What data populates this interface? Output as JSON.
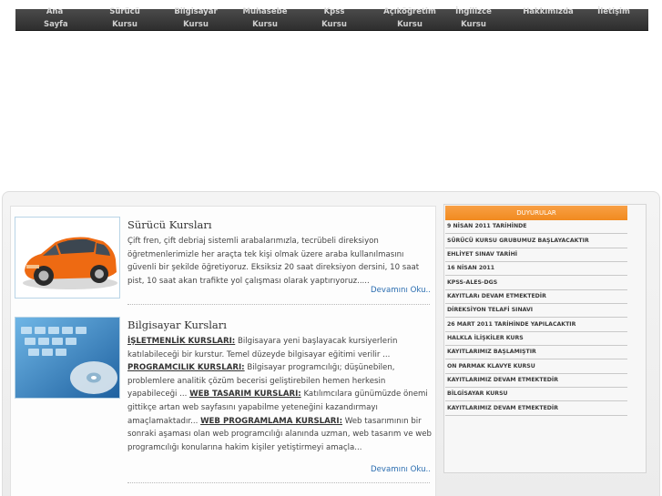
{
  "nav": {
    "items": [
      {
        "line1": "Ana",
        "line2": "Sayfa"
      },
      {
        "line1": "Sürücü",
        "line2": "Kursu"
      },
      {
        "line1": "Bilgisayar",
        "line2": "Kursu"
      },
      {
        "line1": "Muhasebe",
        "line2": "Kursu"
      },
      {
        "line1": "Kpss",
        "line2": "Kursu"
      },
      {
        "line1": "Açıköğretim",
        "line2": "Kursu"
      },
      {
        "line1": "İngilizce",
        "line2": "Kursu"
      },
      {
        "line1": "Hakkımızda",
        "line2": ""
      },
      {
        "line1": "İletişim",
        "line2": ""
      }
    ]
  },
  "courses": [
    {
      "title": "Sürücü Kursları",
      "text": "Çift fren, çift debriaj sistemli arabalarımızla, tecrübeli direksiyon öğretmenlerimizle her araçta tek kişi olmak üzere araba kullanılmasını güvenli bir şekilde öğretiyoruz. Eksiksiz 20 saat direksiyon dersini, 10 saat pist, 10 saat akan trafikte yol çalışması olarak yaptırıyoruz.....",
      "more": "Devamını Oku.."
    },
    {
      "title": "Bilgisayar Kursları",
      "p1_head": "İŞLETMENLİK KURSLARI:",
      "p1": " Bilgisayara yeni başlayacak kursiyerlerin katılabileceği bir kurstur. Temel düzeyde bilgisayar eğitimi verilir ...",
      "p2_head": "PROGRAMCILIK KURSLARI:",
      "p2": " Bilgisayar programcılığı; düşünebilen, problemlere analitik çözüm becerisi geliştirebilen hemen herkesin yapabileceği ...",
      "p3_head": "WEB TASARIM KURSLARI:",
      "p3": " Katılımcılara günümüzde önemi gittikçe artan web sayfasını yapabilme yeteneğini kazandırmayı amaçlamaktadır...",
      "p4_head": "WEB PROGRAMLAMA KURSLARI:",
      "p4": " Web tasarımının bir sonraki aşaması olan web programcılığı alanında uzman, web tasarım ve web programcılığı konularına hakim kişiler yetiştirmeyi amaçla...",
      "more": "Devamını Oku.."
    }
  ],
  "announcements": {
    "title": "DUYURULAR",
    "items": [
      "9 NİSAN 2011 TARİHİNDE",
      "SÜRÜCÜ KURSU GRUBUMUZ BAŞLAYACAKTIR",
      "EHLİYET SINAV TARİHİ",
      "16 NİSAN 2011",
      "KPSS-ALES-DGS",
      "KAYITLARı DEVAM ETMEKTEDİR",
      "DİREKSİYON TELAFİ SINAVI",
      "26 MART 2011 TARİHİNDE YAPILACAKTIR",
      "HALKLA İLİŞKİLER KURS",
      "KAYITLARIMIZ BAŞLAMIŞTIR",
      "ON PARMAK KLAVYE KURSU",
      "KAYITLARIMIZ DEVAM ETMEKTEDİR",
      "BİLGİSAYAR KURSU",
      "KAYITLARIMIZ DEVAM ETMEKTEDİR"
    ]
  }
}
